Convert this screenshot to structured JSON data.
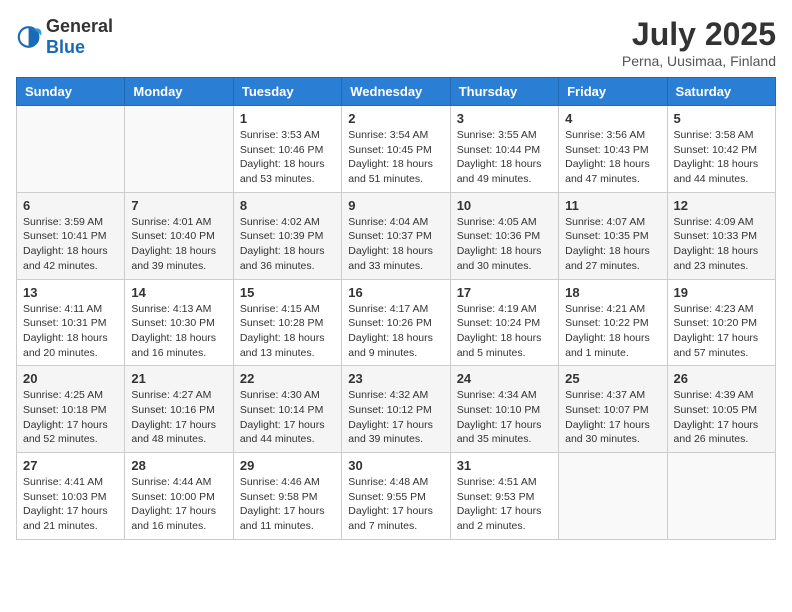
{
  "header": {
    "logo_general": "General",
    "logo_blue": "Blue",
    "month_title": "July 2025",
    "location": "Perna, Uusimaa, Finland"
  },
  "weekdays": [
    "Sunday",
    "Monday",
    "Tuesday",
    "Wednesday",
    "Thursday",
    "Friday",
    "Saturday"
  ],
  "weeks": [
    [
      {
        "day": "",
        "sunrise": "",
        "sunset": "",
        "daylight": ""
      },
      {
        "day": "",
        "sunrise": "",
        "sunset": "",
        "daylight": ""
      },
      {
        "day": "1",
        "sunrise": "Sunrise: 3:53 AM",
        "sunset": "Sunset: 10:46 PM",
        "daylight": "Daylight: 18 hours and 53 minutes."
      },
      {
        "day": "2",
        "sunrise": "Sunrise: 3:54 AM",
        "sunset": "Sunset: 10:45 PM",
        "daylight": "Daylight: 18 hours and 51 minutes."
      },
      {
        "day": "3",
        "sunrise": "Sunrise: 3:55 AM",
        "sunset": "Sunset: 10:44 PM",
        "daylight": "Daylight: 18 hours and 49 minutes."
      },
      {
        "day": "4",
        "sunrise": "Sunrise: 3:56 AM",
        "sunset": "Sunset: 10:43 PM",
        "daylight": "Daylight: 18 hours and 47 minutes."
      },
      {
        "day": "5",
        "sunrise": "Sunrise: 3:58 AM",
        "sunset": "Sunset: 10:42 PM",
        "daylight": "Daylight: 18 hours and 44 minutes."
      }
    ],
    [
      {
        "day": "6",
        "sunrise": "Sunrise: 3:59 AM",
        "sunset": "Sunset: 10:41 PM",
        "daylight": "Daylight: 18 hours and 42 minutes."
      },
      {
        "day": "7",
        "sunrise": "Sunrise: 4:01 AM",
        "sunset": "Sunset: 10:40 PM",
        "daylight": "Daylight: 18 hours and 39 minutes."
      },
      {
        "day": "8",
        "sunrise": "Sunrise: 4:02 AM",
        "sunset": "Sunset: 10:39 PM",
        "daylight": "Daylight: 18 hours and 36 minutes."
      },
      {
        "day": "9",
        "sunrise": "Sunrise: 4:04 AM",
        "sunset": "Sunset: 10:37 PM",
        "daylight": "Daylight: 18 hours and 33 minutes."
      },
      {
        "day": "10",
        "sunrise": "Sunrise: 4:05 AM",
        "sunset": "Sunset: 10:36 PM",
        "daylight": "Daylight: 18 hours and 30 minutes."
      },
      {
        "day": "11",
        "sunrise": "Sunrise: 4:07 AM",
        "sunset": "Sunset: 10:35 PM",
        "daylight": "Daylight: 18 hours and 27 minutes."
      },
      {
        "day": "12",
        "sunrise": "Sunrise: 4:09 AM",
        "sunset": "Sunset: 10:33 PM",
        "daylight": "Daylight: 18 hours and 23 minutes."
      }
    ],
    [
      {
        "day": "13",
        "sunrise": "Sunrise: 4:11 AM",
        "sunset": "Sunset: 10:31 PM",
        "daylight": "Daylight: 18 hours and 20 minutes."
      },
      {
        "day": "14",
        "sunrise": "Sunrise: 4:13 AM",
        "sunset": "Sunset: 10:30 PM",
        "daylight": "Daylight: 18 hours and 16 minutes."
      },
      {
        "day": "15",
        "sunrise": "Sunrise: 4:15 AM",
        "sunset": "Sunset: 10:28 PM",
        "daylight": "Daylight: 18 hours and 13 minutes."
      },
      {
        "day": "16",
        "sunrise": "Sunrise: 4:17 AM",
        "sunset": "Sunset: 10:26 PM",
        "daylight": "Daylight: 18 hours and 9 minutes."
      },
      {
        "day": "17",
        "sunrise": "Sunrise: 4:19 AM",
        "sunset": "Sunset: 10:24 PM",
        "daylight": "Daylight: 18 hours and 5 minutes."
      },
      {
        "day": "18",
        "sunrise": "Sunrise: 4:21 AM",
        "sunset": "Sunset: 10:22 PM",
        "daylight": "Daylight: 18 hours and 1 minute."
      },
      {
        "day": "19",
        "sunrise": "Sunrise: 4:23 AM",
        "sunset": "Sunset: 10:20 PM",
        "daylight": "Daylight: 17 hours and 57 minutes."
      }
    ],
    [
      {
        "day": "20",
        "sunrise": "Sunrise: 4:25 AM",
        "sunset": "Sunset: 10:18 PM",
        "daylight": "Daylight: 17 hours and 52 minutes."
      },
      {
        "day": "21",
        "sunrise": "Sunrise: 4:27 AM",
        "sunset": "Sunset: 10:16 PM",
        "daylight": "Daylight: 17 hours and 48 minutes."
      },
      {
        "day": "22",
        "sunrise": "Sunrise: 4:30 AM",
        "sunset": "Sunset: 10:14 PM",
        "daylight": "Daylight: 17 hours and 44 minutes."
      },
      {
        "day": "23",
        "sunrise": "Sunrise: 4:32 AM",
        "sunset": "Sunset: 10:12 PM",
        "daylight": "Daylight: 17 hours and 39 minutes."
      },
      {
        "day": "24",
        "sunrise": "Sunrise: 4:34 AM",
        "sunset": "Sunset: 10:10 PM",
        "daylight": "Daylight: 17 hours and 35 minutes."
      },
      {
        "day": "25",
        "sunrise": "Sunrise: 4:37 AM",
        "sunset": "Sunset: 10:07 PM",
        "daylight": "Daylight: 17 hours and 30 minutes."
      },
      {
        "day": "26",
        "sunrise": "Sunrise: 4:39 AM",
        "sunset": "Sunset: 10:05 PM",
        "daylight": "Daylight: 17 hours and 26 minutes."
      }
    ],
    [
      {
        "day": "27",
        "sunrise": "Sunrise: 4:41 AM",
        "sunset": "Sunset: 10:03 PM",
        "daylight": "Daylight: 17 hours and 21 minutes."
      },
      {
        "day": "28",
        "sunrise": "Sunrise: 4:44 AM",
        "sunset": "Sunset: 10:00 PM",
        "daylight": "Daylight: 17 hours and 16 minutes."
      },
      {
        "day": "29",
        "sunrise": "Sunrise: 4:46 AM",
        "sunset": "Sunset: 9:58 PM",
        "daylight": "Daylight: 17 hours and 11 minutes."
      },
      {
        "day": "30",
        "sunrise": "Sunrise: 4:48 AM",
        "sunset": "Sunset: 9:55 PM",
        "daylight": "Daylight: 17 hours and 7 minutes."
      },
      {
        "day": "31",
        "sunrise": "Sunrise: 4:51 AM",
        "sunset": "Sunset: 9:53 PM",
        "daylight": "Daylight: 17 hours and 2 minutes."
      },
      {
        "day": "",
        "sunrise": "",
        "sunset": "",
        "daylight": ""
      },
      {
        "day": "",
        "sunrise": "",
        "sunset": "",
        "daylight": ""
      }
    ]
  ]
}
